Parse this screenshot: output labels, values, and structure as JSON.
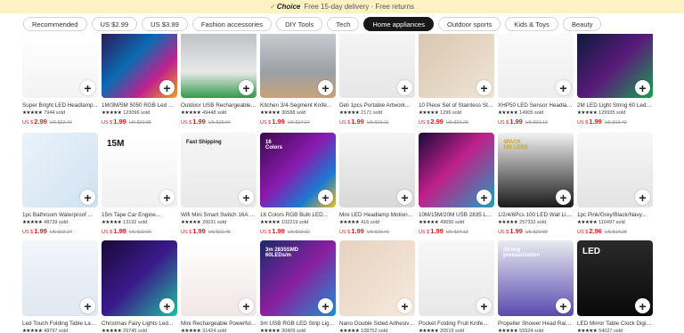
{
  "banner": {
    "check": "✓",
    "brand": "Choice",
    "text": "Free 15-day delivery · Free returns"
  },
  "tabs": [
    {
      "label": "Recommended",
      "active": false
    },
    {
      "label": "US $2.99",
      "active": false
    },
    {
      "label": "US $3.99",
      "active": false
    },
    {
      "label": "Fashion accessories",
      "active": false
    },
    {
      "label": "DIY Tools",
      "active": false
    },
    {
      "label": "Tech",
      "active": false
    },
    {
      "label": "Home appliances",
      "active": true
    },
    {
      "label": "Outdoor sports",
      "active": false
    },
    {
      "label": "Kids & Toys",
      "active": false
    },
    {
      "label": "Beauty",
      "active": false
    }
  ],
  "products": [
    {
      "title": "Super Bright LED Headlamp...",
      "sold": "7944 sold",
      "cur": "US $",
      "price": "2.99",
      "old": "US $22.40",
      "art": "linear-gradient(180deg,#ffffff 0%,#f3f3f3 100%)",
      "accent": "#1a1a1a"
    },
    {
      "title": "1M/3M/5M 5050 RGB Led Stri...",
      "sold": "123096 sold",
      "cur": "US $",
      "price": "1.99",
      "old": "US $20.85",
      "art": "linear-gradient(135deg,#2b1a5a 0%,#0b6bb0 40%,#c02090 70%,#f0a020 100%)",
      "accent": "#ffffff"
    },
    {
      "title": "Outdoor USB Rechargeable LE...",
      "sold": "49448 sold",
      "cur": "US $",
      "price": "1.99",
      "old": "US $20.04",
      "art": "linear-gradient(180deg,#bfc3c6 0%,#e8e8e8 60%,#2f9a4a 100%)",
      "accent": "#ffffff"
    },
    {
      "title": "Kitchen 3/4-Segment Knife...",
      "sold": "30588 sold",
      "cur": "US $",
      "price": "1.99",
      "old": "US $17.07",
      "art": "linear-gradient(180deg,#c8cbcf 0%,#9aa0a5 60%,#c9a27a 100%)",
      "accent": "#333"
    },
    {
      "title": "Deli 1pcs Portable Artwork...",
      "sold": "2171 sold",
      "cur": "US $",
      "price": "1.99",
      "old": "US $10.11",
      "art": "linear-gradient(180deg,#f4f4f4 0%,#e6e6e6 100%)",
      "accent": "#1f3b5a"
    },
    {
      "title": "10 Piece Set of Stainless Steel...",
      "sold": "1296 sold",
      "cur": "US $",
      "price": "2.99",
      "old": "US $20.29",
      "art": "linear-gradient(135deg,#d9c7b0 0%,#efe4d4 100%)",
      "accent": "#333"
    },
    {
      "title": "XHP50 LED Sensor Headlamp...",
      "sold": "14905 sold",
      "cur": "US $",
      "price": "1.99",
      "old": "US $23.13",
      "art": "linear-gradient(180deg,#fafafa 0%,#ededed 100%)",
      "accent": "#1a1a1a"
    },
    {
      "title": "2M LED Light String 60 Leds...",
      "sold": "129935 sold",
      "cur": "US $",
      "price": "1.99",
      "old": "US $19.42",
      "art": "linear-gradient(135deg,#0d1a3a 0%,#5a1a7a 50%,#18a050 100%)",
      "accent": "#ffffff"
    },
    {
      "title": "1pc Bathroom Waterproof Wa...",
      "sold": "48739 sold",
      "cur": "US $",
      "price": "1.99",
      "old": "US $12.27",
      "art": "linear-gradient(135deg,#eaf3fa 0%,#cfe2f0 100%)",
      "accent": "#555",
      "tag": ""
    },
    {
      "title": "15m Tape Car Engine...",
      "sold": "13192 sold",
      "cur": "US $",
      "price": "1.99",
      "old": "US $10.00",
      "art": "linear-gradient(180deg,#ffffff 0%,#f0f0f0 100%)",
      "accent": "#111",
      "tag": "15M"
    },
    {
      "title": "Wifi Mini Smart Switch 16A Di...",
      "sold": "20031 sold",
      "cur": "US $",
      "price": "1.99",
      "old": "US $22.45",
      "art": "linear-gradient(180deg,#f6f6f6 0%,#e9e9e9 100%)",
      "accent": "#1a1a1a",
      "tag": "Fast Shipping"
    },
    {
      "title": "16 Colors RGB Bulb LED...",
      "sold": "102219 sold",
      "cur": "US $",
      "price": "1.99",
      "old": "US $19.92",
      "art": "linear-gradient(135deg,#3a0a4a 0%,#8a1ab0 45%,#1a7ad0 75%,#f0c020 100%)",
      "accent": "#ffffff",
      "tag": "16\nColors"
    },
    {
      "title": "Mini LED Headlamp Motion...",
      "sold": "416 sold",
      "cur": "US $",
      "price": "1.99",
      "old": "US $10.41",
      "art": "linear-gradient(180deg,#f4f4f4 0%,#d8d8d8 100%)",
      "accent": "#111",
      "tag": ""
    },
    {
      "title": "10M/15M/20M USB 2835 LED...",
      "sold": "49650 sold",
      "cur": "US $",
      "price": "1.99",
      "old": "US $24.13",
      "art": "linear-gradient(135deg,#1a0a3a 0%,#c0208a 45%,#20a0c0 100%)",
      "accent": "#ffffff",
      "tag": ""
    },
    {
      "title": "1/2/4/6Pcs 100 LED Wall Light...",
      "sold": "257332 sold",
      "cur": "US $",
      "price": "1.99",
      "old": "US $22.99",
      "art": "linear-gradient(180deg,#f3f3f3 0%,#1a1a1a 100%)",
      "accent": "#e0a000",
      "tag": "4PACK\n100 LEDS"
    },
    {
      "title": "1pc Pink/Grey/Black/Navy...",
      "sold": "116497 sold",
      "cur": "US $",
      "price": "2.96",
      "old": "US $14.28",
      "art": "linear-gradient(180deg,#f7f7f7 0%,#e3e3e3 100%)",
      "accent": "#666",
      "tag": ""
    },
    {
      "title": "Led Touch Folding Table Lam...",
      "sold": "48797 sold",
      "cur": "",
      "price": "",
      "old": "",
      "art": "linear-gradient(180deg,#f2f6fb 0%,#dfe7f0 100%)",
      "accent": "#555",
      "tag": ""
    },
    {
      "title": "Christmas Fairy Lights Led...",
      "sold": "29745 sold",
      "cur": "",
      "price": "",
      "old": "",
      "art": "linear-gradient(135deg,#1a0a3a 0%,#3a1a8a 50%,#20c0a0 100%)",
      "accent": "#ffffff",
      "tag": ""
    },
    {
      "title": "Mini Rechargeable Powerful...",
      "sold": "31424 sold",
      "cur": "",
      "price": "",
      "old": "",
      "art": "linear-gradient(180deg,#ffffff 0%,#f0e6e6 100%)",
      "accent": "#c02020",
      "tag": ""
    },
    {
      "title": "3m USB RGB LED Strip Light...",
      "sold": "30409 sold",
      "cur": "",
      "price": "",
      "old": "",
      "art": "linear-gradient(135deg,#1a2a6a 0%,#8a20a0 50%,#2090d0 100%)",
      "accent": "#ffffff",
      "tag": "3m 2835SMD\n60LEDs/m"
    },
    {
      "title": "Nano Double Sided Adhesive...",
      "sold": "108752 sold",
      "cur": "",
      "price": "",
      "old": "",
      "art": "linear-gradient(135deg,#e8d2bf 0%,#f5e9dd 100%)",
      "accent": "#555",
      "tag": ""
    },
    {
      "title": "Pocket Folding Fruit Knife...",
      "sold": "20519 sold",
      "cur": "",
      "price": "",
      "old": "",
      "art": "linear-gradient(180deg,#f7f7f7 0%,#e8e8e8 100%)",
      "accent": "#333",
      "tag": ""
    },
    {
      "title": "Propeller Shower Head Rainfa...",
      "sold": "55924 sold",
      "cur": "",
      "price": "",
      "old": "",
      "art": "linear-gradient(180deg,#e8eaf0 0%,#5a4ab0 100%)",
      "accent": "#ffffff",
      "tag": "Strong\npressurization"
    },
    {
      "title": "LED Mirror Table Clock Digital...",
      "sold": "54027 sold",
      "cur": "",
      "price": "",
      "old": "",
      "art": "linear-gradient(180deg,#2a2a2a 0%,#0a0a0a 100%)",
      "accent": "#ffffff",
      "tag": "LED"
    }
  ],
  "card_labels": {
    "add": "+",
    "stars": "★★★★★"
  },
  "colors": {
    "price": "#e02020",
    "active_tab": "#191919",
    "banner_bg": "#fdf2c2"
  },
  "icons": {
    "add": "plus-icon",
    "verified": "check-icon"
  }
}
